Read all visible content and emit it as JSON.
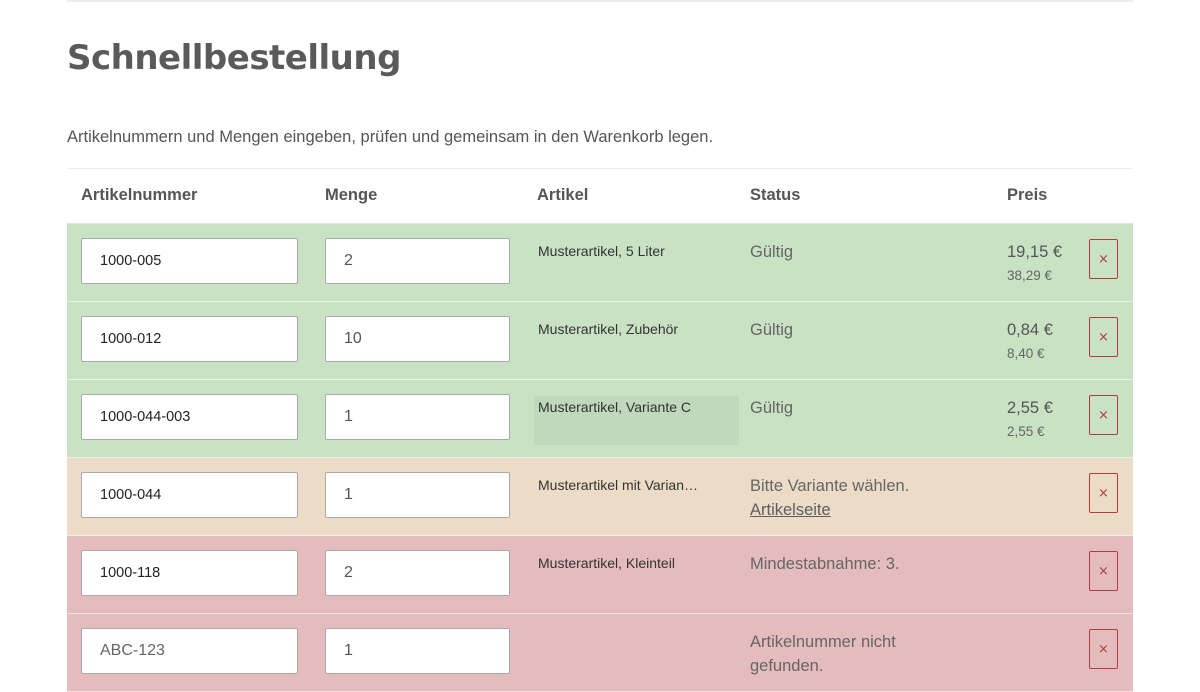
{
  "page": {
    "title": "Schnellbestellung",
    "intro": "Artikelnummern und Mengen eingeben, prüfen und gemeinsam in den Warenkorb legen."
  },
  "table": {
    "headers": {
      "sku": "Artikelnummer",
      "qty": "Menge",
      "article": "Artikel",
      "status": "Status",
      "price": "Preis"
    },
    "rows": [
      {
        "sku": "1000-005",
        "qty": "2",
        "article": "Musterartikel, 5 Liter",
        "status": "Gültig",
        "link": "",
        "price": "19,15 €",
        "total": "38,29 €",
        "state": "ok",
        "delete": "×"
      },
      {
        "sku": "1000-012",
        "qty": "10",
        "article": "Musterartikel, Zubehör",
        "status": "Gültig",
        "link": "",
        "price": "0,84 €",
        "total": "8,40 €",
        "state": "ok",
        "delete": "×"
      },
      {
        "sku": "1000-044-003",
        "qty": "1",
        "article": "Musterartikel, Variante C",
        "status": "Gültig",
        "link": "",
        "price": "2,55 €",
        "total": "2,55 €",
        "state": "ok",
        "delete": "×"
      },
      {
        "sku": "1000-044",
        "qty": "1",
        "article": "Musterartikel mit Varian…",
        "status": "Bitte Variante wählen.",
        "link": "Artikelseite",
        "price": "",
        "total": "",
        "state": "warn",
        "delete": "×"
      },
      {
        "sku": "1000-118",
        "qty": "2",
        "article": "Musterartikel, Kleinteil",
        "status": "Mindestabnahme: 3.",
        "link": "",
        "price": "",
        "total": "",
        "state": "err",
        "delete": "×"
      },
      {
        "sku": "ABC-123",
        "qty": "1",
        "article": "",
        "status": "Artikelnummer nicht gefunden.",
        "link": "",
        "price": "",
        "total": "",
        "state": "err",
        "delete": "×"
      }
    ]
  },
  "colors": {
    "valid_row": "#c8e2c3",
    "warning_row": "#ecdcc7",
    "error_row": "#e5bcbd",
    "delete_accent": "#b53c3c"
  },
  "icons": {
    "delete": "close-icon"
  }
}
